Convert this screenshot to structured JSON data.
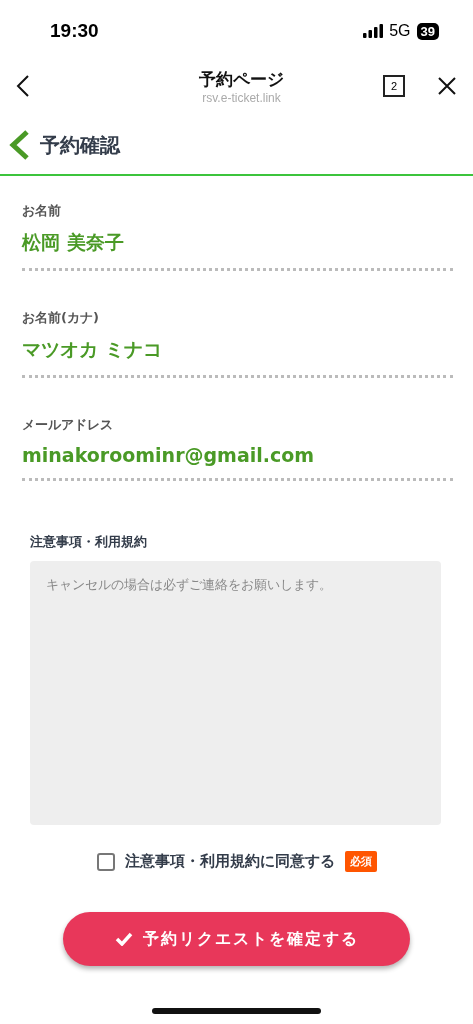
{
  "status_bar": {
    "time": "19:30",
    "network": "5G",
    "battery": "39"
  },
  "browser_bar": {
    "title": "予約ページ",
    "url": "rsv.e-ticket.link",
    "tab_count": "2"
  },
  "header": {
    "title": "予約確認"
  },
  "fields": [
    {
      "label": "お名前",
      "value": "松岡 美奈子"
    },
    {
      "label": "お名前(カナ)",
      "value": "マツオカ ミナコ"
    },
    {
      "label": "メールアドレス",
      "value": "minakoroominr@gmail.com"
    }
  ],
  "terms": {
    "title": "注意事項・利用規約",
    "text": "キャンセルの場合は必ずご連絡をお願いします。"
  },
  "agree": {
    "label": "注意事項・利用規約に同意する",
    "checked": false,
    "badge": "必須"
  },
  "submit_button": {
    "label": "予約リクエストを確定する"
  }
}
